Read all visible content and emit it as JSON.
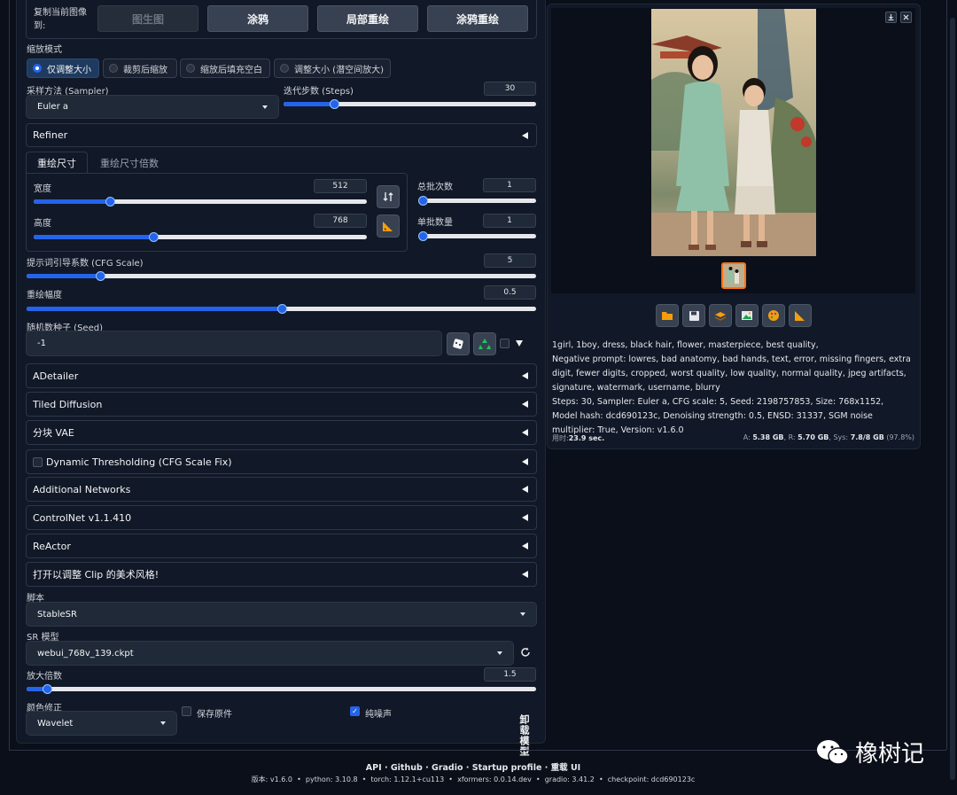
{
  "copy_to": {
    "label": "复制当前图像到:",
    "buttons": [
      "图生图",
      "涂鸦",
      "局部重绘",
      "涂鸦重绘"
    ]
  },
  "resize_mode": {
    "label": "缩放模式",
    "options": [
      "仅调整大小",
      "裁剪后缩放",
      "缩放后填充空白",
      "调整大小 (潜空间放大)"
    ],
    "selected": 0
  },
  "sampler": {
    "label": "采样方法 (Sampler)",
    "value": "Euler a"
  },
  "steps": {
    "label": "迭代步数 (Steps)",
    "value": "30",
    "fraction": 0.2
  },
  "refiner": {
    "label": "Refiner"
  },
  "size_tabs": [
    "重绘尺寸",
    "重绘尺寸倍数"
  ],
  "width": {
    "label": "宽度",
    "value": "512",
    "fraction": 0.23
  },
  "height": {
    "label": "高度",
    "value": "768",
    "fraction": 0.36
  },
  "batch_count": {
    "label": "总批次数",
    "value": "1",
    "fraction": 0.0
  },
  "batch_size": {
    "label": "单批数量",
    "value": "1",
    "fraction": 0.0
  },
  "cfg": {
    "label": "提示词引导系数 (CFG Scale)",
    "value": "5",
    "fraction": 0.145
  },
  "denoise": {
    "label": "重绘幅度",
    "value": "0.5",
    "fraction": 0.5
  },
  "seed": {
    "label": "随机数种子 (Seed)",
    "value": "-1"
  },
  "accordions": [
    "ADetailer",
    "Tiled Diffusion",
    "分块 VAE",
    "Dynamic Thresholding (CFG Scale Fix)",
    "Additional Networks",
    "ControlNet v1.1.410",
    "ReActor",
    "打开以调整 Clip 的美术风格!"
  ],
  "script": {
    "label": "脚本",
    "value": "StableSR"
  },
  "sr_model": {
    "label": "SR 模型",
    "value": "webui_768v_139.ckpt"
  },
  "scale": {
    "label": "放大倍数",
    "value": "1.5",
    "fraction": 0.04
  },
  "color_fix": {
    "label": "颜色修正",
    "value": "Wavelet"
  },
  "save_original": {
    "label": "保存原件",
    "checked": false
  },
  "pure_noise": {
    "label": "纯噪声",
    "checked": true
  },
  "unload_model": "卸载模型",
  "output": {
    "prompt": "1girl, 1boy, dress, black hair, flower, masterpiece, best quality,",
    "negative": "Negative prompt: lowres, bad anatomy, bad hands, text, error, missing fingers, extra digit, fewer digits, cropped, worst quality, low quality, normal quality, jpeg artifacts, signature, watermark, username, blurry",
    "params": "Steps: 30, Sampler: Euler a, CFG scale: 5, Seed: 2198757853, Size: 768x1152, Model hash: dcd690123c, Denoising strength: 0.5, ENSD: 31337, SGM noise multiplier: True, Version: v1.6.0",
    "time_label": "用时:",
    "time_value": "23.9 sec.",
    "mem_a_label": "A:",
    "mem_a": "5.38 GB",
    "mem_r_label": "R:",
    "mem_r": "5.70 GB",
    "mem_sys_label": "Sys:",
    "mem_sys": "7.8/8 GB",
    "mem_pct": "(97.8%)"
  },
  "footer": {
    "links": [
      "API",
      "Github",
      "Gradio",
      "Startup profile",
      "重载 UI"
    ],
    "version_line": "版本: v1.6.0  •  python: 3.10.8  •  torch: 1.12.1+cu113  •  xformers: 0.0.14.dev  •  gradio: 3.41.2  •  checkpoint: dcd690123c"
  },
  "watermark": "橡树记",
  "colors": {
    "accent": "#2563eb",
    "background": "#0b0f19",
    "panel": "#111827",
    "selected_thumb_border": "#f97316"
  },
  "icons": [
    "swap-icon",
    "ruler-icon",
    "dice-icon",
    "recycle-icon",
    "refresh-icon",
    "folder-icon",
    "save-icon",
    "zip-icon",
    "image-icon",
    "palette-icon",
    "ruler-icon",
    "download-icon",
    "close-icon"
  ]
}
